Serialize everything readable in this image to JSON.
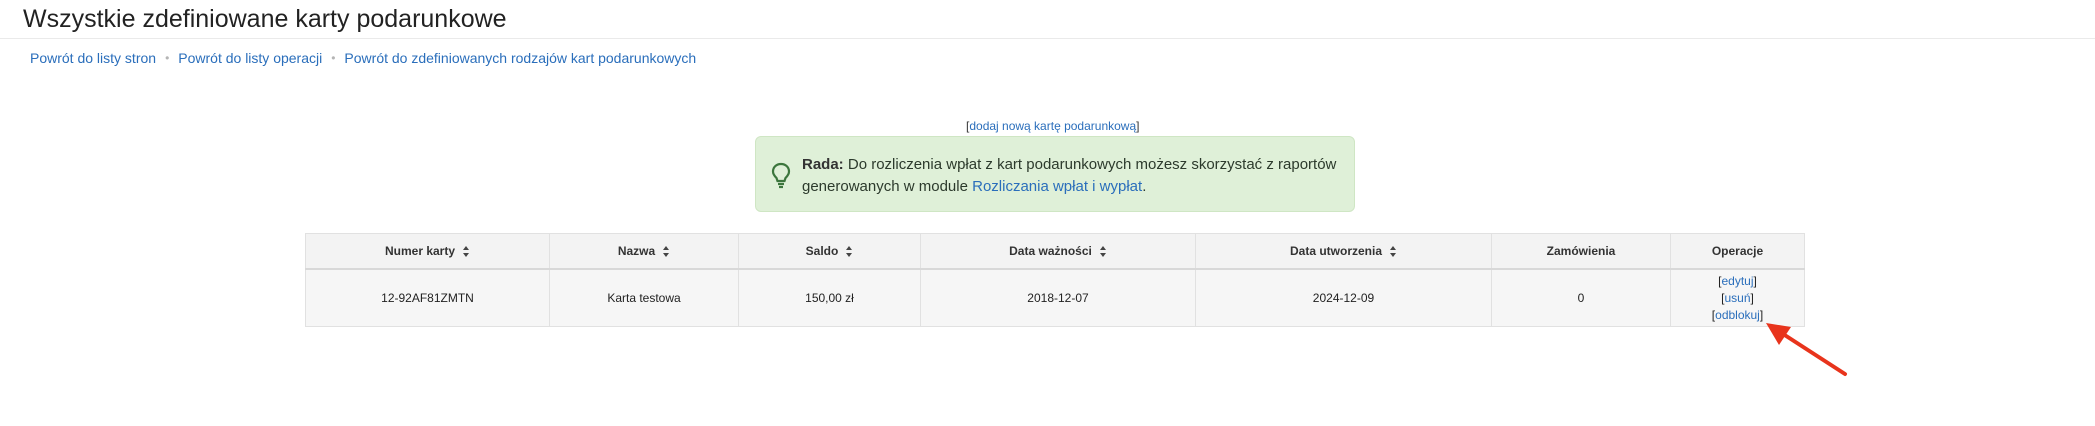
{
  "page": {
    "title": "Wszystkie zdefiniowane karty podarunkowe"
  },
  "breadcrumbs": [
    "Powrót do listy stron",
    "Powrót do listy operacji",
    "Powrót do zdefiniowanych rodzajów kart podarunkowych"
  ],
  "actions": {
    "add_card": "dodaj nową kartę podarunkową"
  },
  "tip": {
    "label": "Rada:",
    "text": "Do rozliczenia wpłat z kart podarunkowych możesz skorzystać z raportów generowanych w module",
    "link": "Rozliczania wpłat i wypłat",
    "end": "."
  },
  "table": {
    "columns": [
      "Numer karty",
      "Nazwa",
      "Saldo",
      "Data ważności",
      "Data utworzenia",
      "Zamówienia",
      "Operacje"
    ],
    "rows": [
      {
        "number": "12-92AF81ZMTN",
        "name": "Karta testowa",
        "balance": "150,00 zł",
        "expiry": "2018-12-07",
        "created": "2024-12-09",
        "orders": "0",
        "ops": {
          "edit": "edytuj",
          "delete": "usuń",
          "unlock": "odblokuj"
        }
      }
    ]
  },
  "colors": {
    "link": "#2a6ebb",
    "tip_bg": "#dff0d8",
    "arrow": "#e8341c"
  },
  "icons": {
    "tip": "lightbulb-icon",
    "sort": "sort-icon",
    "annotation": "arrow-icon"
  }
}
